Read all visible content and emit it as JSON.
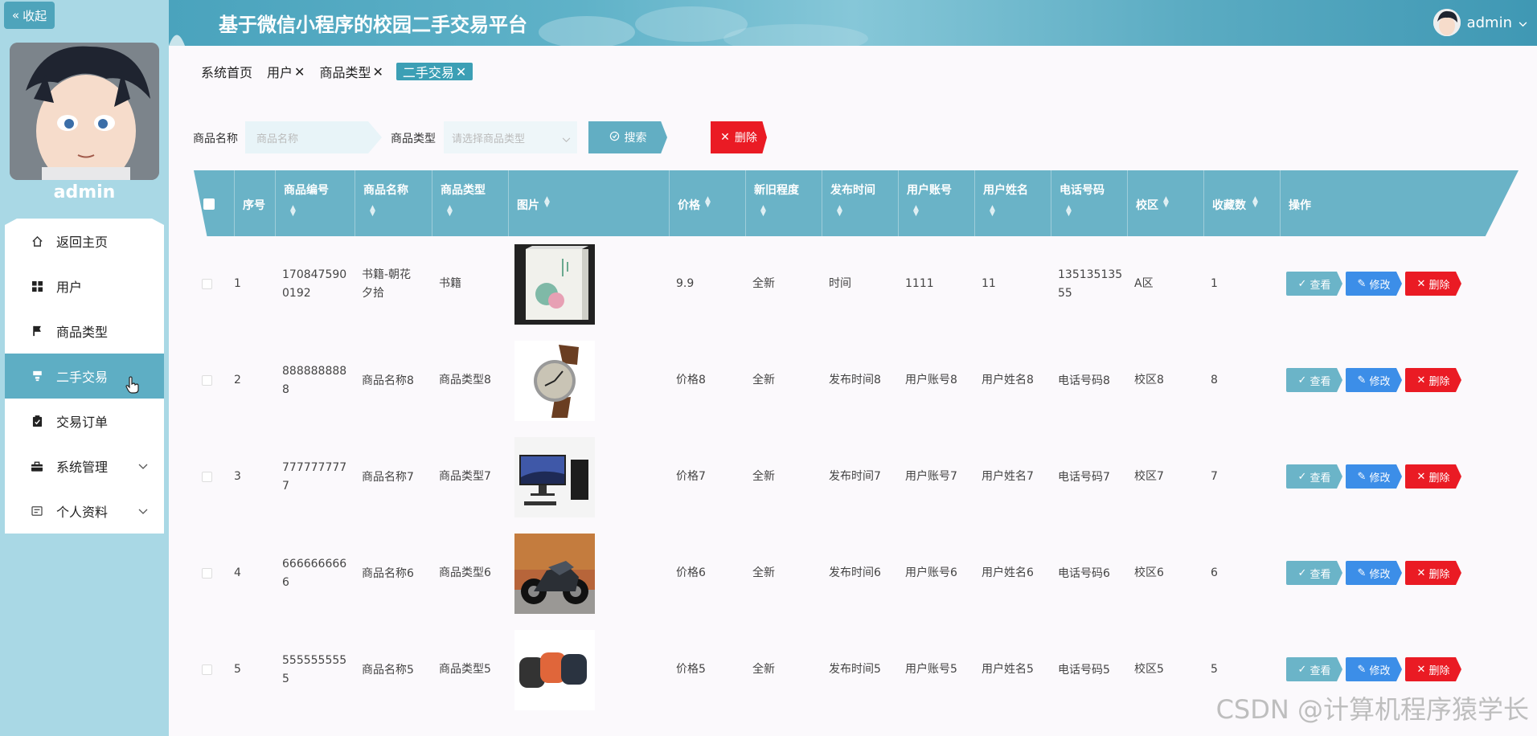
{
  "app": {
    "title": "基于微信小程序的校园二手交易平台",
    "user": "admin"
  },
  "sidebar": {
    "collapse_label": "收起",
    "username": "admin",
    "items": [
      {
        "label": "返回主页",
        "icon": "home-icon"
      },
      {
        "label": "用户",
        "icon": "grid-icon"
      },
      {
        "label": "商品类型",
        "icon": "flag-icon"
      },
      {
        "label": "二手交易",
        "icon": "trade-icon",
        "active": true
      },
      {
        "label": "交易订单",
        "icon": "clipboard-icon"
      },
      {
        "label": "系统管理",
        "icon": "briefcase-icon"
      },
      {
        "label": "个人资料",
        "icon": "card-icon"
      }
    ]
  },
  "tabs": [
    {
      "label": "系统首页",
      "closable": false
    },
    {
      "label": "用户",
      "closable": true
    },
    {
      "label": "商品类型",
      "closable": true
    },
    {
      "label": "二手交易",
      "closable": true,
      "active": true
    }
  ],
  "search": {
    "name_label": "商品名称",
    "name_placeholder": "商品名称",
    "type_label": "商品类型",
    "type_placeholder": "请选择商品类型",
    "search_button": "搜索",
    "delete_button": "删除"
  },
  "table": {
    "columns": [
      "序号",
      "商品编号",
      "商品名称",
      "商品类型",
      "图片",
      "价格",
      "新旧程度",
      "发布时间",
      "用户账号",
      "用户姓名",
      "电话号码",
      "校区",
      "收藏数",
      "操作"
    ],
    "rows": [
      {
        "idx": "1",
        "code": [
          "170847590",
          "0192"
        ],
        "name": [
          "书籍-朝花",
          "夕拾"
        ],
        "type": "书籍",
        "price": "9.9",
        "cond": "全新",
        "time": "时间",
        "acct": "1111",
        "uname": "11",
        "phone": [
          "135135135",
          "55"
        ],
        "campus": "A区",
        "fav": "1",
        "img": "book"
      },
      {
        "idx": "2",
        "code": [
          "888888888",
          "8"
        ],
        "name": [
          "商品名称8"
        ],
        "type": "商品类型8",
        "price": "价格8",
        "cond": "全新",
        "time": "发布时间8",
        "acct": "用户账号8",
        "uname": "用户姓名8",
        "phone": [
          "电话号码8"
        ],
        "campus": "校区8",
        "fav": "8",
        "img": "watch"
      },
      {
        "idx": "3",
        "code": [
          "777777777",
          "7"
        ],
        "name": [
          "商品名称7"
        ],
        "type": "商品类型7",
        "price": "价格7",
        "cond": "全新",
        "time": "发布时间7",
        "acct": "用户账号7",
        "uname": "用户姓名7",
        "phone": [
          "电话号码7"
        ],
        "campus": "校区7",
        "fav": "7",
        "img": "pc"
      },
      {
        "idx": "4",
        "code": [
          "666666666",
          "6"
        ],
        "name": [
          "商品名称6"
        ],
        "type": "商品类型6",
        "price": "价格6",
        "cond": "全新",
        "time": "发布时间6",
        "acct": "用户账号6",
        "uname": "用户姓名6",
        "phone": [
          "电话号码6"
        ],
        "campus": "校区6",
        "fav": "6",
        "img": "moto"
      },
      {
        "idx": "5",
        "code": [
          "555555555",
          "5"
        ],
        "name": [
          "商品名称5"
        ],
        "type": "商品类型5",
        "price": "价格5",
        "cond": "全新",
        "time": "发布时间5",
        "acct": "用户账号5",
        "uname": "用户姓名5",
        "phone": [
          "电话号码5"
        ],
        "campus": "校区5",
        "fav": "5",
        "img": "speaker"
      }
    ],
    "actions": {
      "view": "查看",
      "edit": "修改",
      "delete": "删除"
    }
  },
  "watermark": "CSDN @计算机程序猿学长",
  "colors": {
    "accent": "#5eaec4",
    "danger": "#ea1b24",
    "edit": "#3c8ee8",
    "sidebar_bg": "#a9d8e5"
  }
}
